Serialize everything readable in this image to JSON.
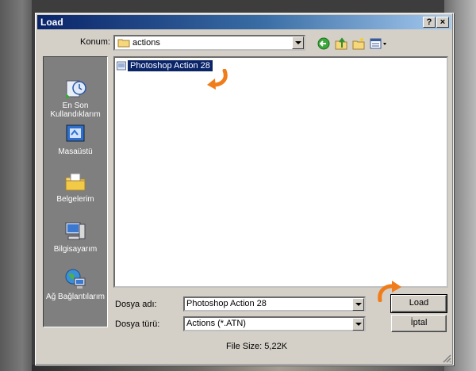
{
  "dialog": {
    "title": "Load",
    "help_glyph": "?",
    "close_glyph": "×"
  },
  "look_in": {
    "label": "Konum:",
    "value": "actions"
  },
  "toolbar_icons": [
    "back-icon",
    "up-folder-icon",
    "new-folder-icon",
    "view-menu-icon"
  ],
  "places": [
    {
      "label": "En Son Kullandıklarım",
      "icon": "recent-documents-icon"
    },
    {
      "label": "Masaüstü",
      "icon": "desktop-icon"
    },
    {
      "label": "Belgelerim",
      "icon": "my-documents-icon"
    },
    {
      "label": "Bilgisayarım",
      "icon": "my-computer-icon"
    },
    {
      "label": "Ağ Bağlantılarım",
      "icon": "network-places-icon"
    }
  ],
  "files": [
    {
      "name": "Photoshop Action 28",
      "selected": true
    }
  ],
  "file_name": {
    "label": "Dosya adı:",
    "value": "Photoshop Action 28"
  },
  "file_type": {
    "label": "Dosya türü:",
    "value": "Actions (*.ATN)"
  },
  "buttons": {
    "load": "Load",
    "cancel": "İptal"
  },
  "file_size": "File Size: 5,22K",
  "colors": {
    "titlebar_start": "#0a246a",
    "titlebar_end": "#a6caf0",
    "selection": "#0a246a",
    "annotation_arrow": "#f07d1a"
  }
}
